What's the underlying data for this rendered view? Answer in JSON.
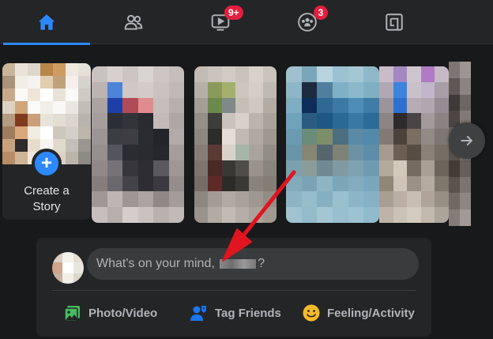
{
  "nav": {
    "tabs": [
      {
        "name": "home",
        "icon": "home-icon",
        "active": true
      },
      {
        "name": "friends",
        "icon": "friends-icon"
      },
      {
        "name": "watch",
        "icon": "watch-icon",
        "badge": "9+"
      },
      {
        "name": "groups",
        "icon": "groups-icon",
        "badge": "3"
      },
      {
        "name": "gaming",
        "icon": "gaming-icon"
      }
    ]
  },
  "stories": {
    "create_label_line1": "Create a",
    "create_label_line2": "Story",
    "next_icon": "arrow-right-icon"
  },
  "composer": {
    "placeholder_prefix": "What's on your mind, ",
    "placeholder_suffix": "?",
    "actions": [
      {
        "label": "Photo/Video",
        "icon": "photo-video-icon",
        "color": "#45bd62"
      },
      {
        "label": "Tag Friends",
        "icon": "tag-friends-icon",
        "color": "#1877f2"
      },
      {
        "label": "Feeling/Activity",
        "icon": "feeling-icon",
        "color": "#f7b928"
      }
    ]
  },
  "colors": {
    "accent": "#2d88ff",
    "badge": "#e41e3f",
    "annotation_arrow": "#e0151f"
  }
}
